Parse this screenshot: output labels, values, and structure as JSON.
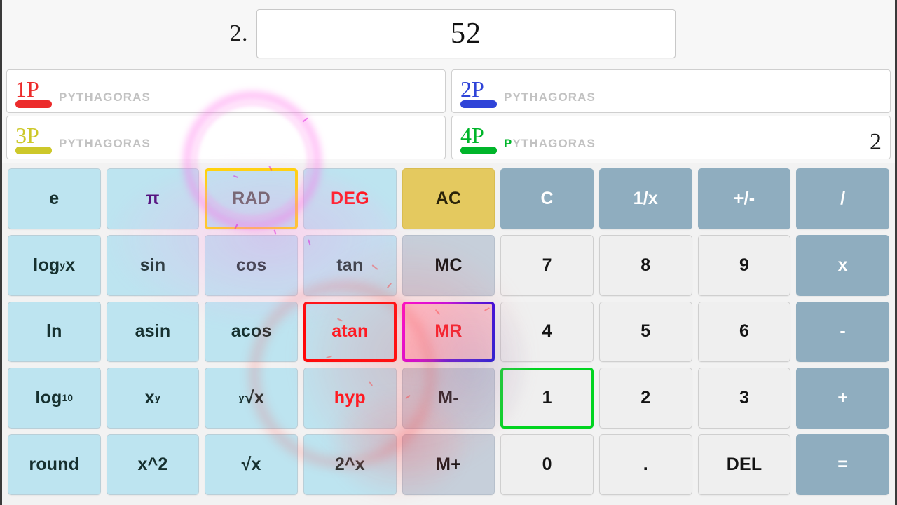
{
  "display": {
    "turn_label": "2.",
    "value": "52"
  },
  "players": [
    {
      "tag": "1P",
      "name": "PYTHAGORAS",
      "score": "",
      "color": "#ec2b2b"
    },
    {
      "tag": "2P",
      "name": "PYTHAGORAS",
      "score": "",
      "color": "#2f44d8"
    },
    {
      "tag": "3P",
      "name": "PYTHAGORAS",
      "score": "",
      "color": "#cdc82a"
    },
    {
      "tag": "4P",
      "name": "PYTHAGORAS",
      "score": "2",
      "color": "#00b52a"
    }
  ],
  "keypad": {
    "rows": [
      [
        {
          "label": "e",
          "kind": "fn"
        },
        {
          "label": "π",
          "kind": "fn",
          "text": "purple"
        },
        {
          "label": "RAD",
          "kind": "fn",
          "text": "gray",
          "select": "yellow"
        },
        {
          "label": "DEG",
          "kind": "fn",
          "text": "red"
        },
        {
          "label": "AC",
          "kind": "ac"
        },
        {
          "label": "C",
          "kind": "op"
        },
        {
          "label": "1/x",
          "kind": "op"
        },
        {
          "label": "+/-",
          "kind": "op"
        },
        {
          "label": "/",
          "kind": "op"
        }
      ],
      [
        {
          "label": "log",
          "kind": "fn",
          "sub": "y",
          "after": "x"
        },
        {
          "label": "sin",
          "kind": "fn"
        },
        {
          "label": "cos",
          "kind": "fn"
        },
        {
          "label": "tan",
          "kind": "fn"
        },
        {
          "label": "MC",
          "kind": "mem"
        },
        {
          "label": "7",
          "kind": "num"
        },
        {
          "label": "8",
          "kind": "num"
        },
        {
          "label": "9",
          "kind": "num"
        },
        {
          "label": "x",
          "kind": "op"
        }
      ],
      [
        {
          "label": "ln",
          "kind": "fn"
        },
        {
          "label": "asin",
          "kind": "fn"
        },
        {
          "label": "acos",
          "kind": "fn"
        },
        {
          "label": "atan",
          "kind": "fn",
          "text": "red",
          "select": "red"
        },
        {
          "label": "MR",
          "kind": "mem",
          "text": "red",
          "select": "magblue"
        },
        {
          "label": "4",
          "kind": "num"
        },
        {
          "label": "5",
          "kind": "num"
        },
        {
          "label": "6",
          "kind": "num"
        },
        {
          "label": "-",
          "kind": "op"
        }
      ],
      [
        {
          "label": "log",
          "kind": "fn",
          "sub": "10"
        },
        {
          "label": "x",
          "kind": "fn",
          "sup": "y"
        },
        {
          "label": "√x",
          "kind": "fn",
          "presup": "y"
        },
        {
          "label": "hyp",
          "kind": "fn",
          "text": "red"
        },
        {
          "label": "M-",
          "kind": "mem"
        },
        {
          "label": "1",
          "kind": "num",
          "select": "green"
        },
        {
          "label": "2",
          "kind": "num"
        },
        {
          "label": "3",
          "kind": "num"
        },
        {
          "label": "+",
          "kind": "op"
        }
      ],
      [
        {
          "label": "round",
          "kind": "fn"
        },
        {
          "label": "x^2",
          "kind": "fn"
        },
        {
          "label": "√x",
          "kind": "fn"
        },
        {
          "label": "2^x",
          "kind": "fn"
        },
        {
          "label": "M+",
          "kind": "mem"
        },
        {
          "label": "0",
          "kind": "num"
        },
        {
          "label": ".",
          "kind": "num"
        },
        {
          "label": "DEL",
          "kind": "num"
        },
        {
          "label": "=",
          "kind": "op"
        }
      ]
    ]
  }
}
